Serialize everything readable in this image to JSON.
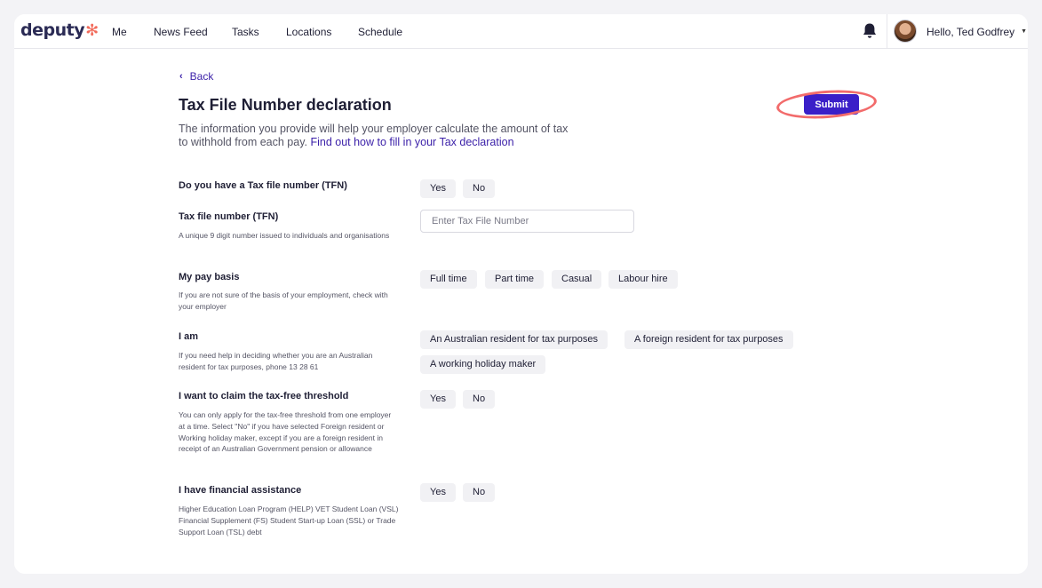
{
  "header": {
    "logo_text": "deputy",
    "nav": [
      "Me",
      "News Feed",
      "Tasks",
      "Locations",
      "Schedule"
    ],
    "user_greeting": "Hello, Ted Godfrey"
  },
  "page": {
    "back_label": "Back",
    "title": "Tax File Number declaration",
    "intro_text": "The information you provide will help your employer calculate the amount of tax to withhold from each pay.",
    "intro_link": "Find out how to fill in your Tax declaration",
    "submit_label": "Submit"
  },
  "form": {
    "has_tfn": {
      "label": "Do you have a Tax file number (TFN)",
      "options": [
        "Yes",
        "No"
      ]
    },
    "tfn": {
      "label": "Tax file number (TFN)",
      "help": "A unique 9 digit number issued to individuals and organisations",
      "placeholder": "Enter Tax File Number",
      "value": ""
    },
    "pay_basis": {
      "label": "My pay basis",
      "help": "If you are not sure of the basis of your employment, check with your employer",
      "options": [
        "Full time",
        "Part time",
        "Casual",
        "Labour hire"
      ]
    },
    "residency": {
      "label": "I am",
      "help": "If you need help in deciding whether you are an Australian resident for tax purposes, phone 13 28 61",
      "options": [
        "An Australian resident for tax purposes",
        "A foreign resident for tax purposes",
        "A working holiday maker"
      ]
    },
    "tax_free_threshold": {
      "label": "I want to claim the tax-free threshold",
      "help": "You can only apply for the tax-free threshold from one employer at a time. Select \"No\" if you have selected Foreign resident or Working holiday maker, except if you are a foreign resident in receipt of an Australian Government pension or allowance",
      "options": [
        "Yes",
        "No"
      ]
    },
    "financial_assistance": {
      "label": "I have financial assistance",
      "help": "Higher Education Loan Program (HELP) VET Student Loan (VSL) Financial Supplement (FS) Student Start-up Loan (SSL) or Trade Support Loan (TSL) debt",
      "options": [
        "Yes",
        "No"
      ]
    }
  },
  "colors": {
    "accent": "#3a1fc8",
    "link": "#3a1fa8",
    "highlight_circle": "#f26b6b",
    "logo_star": "#f26b5b"
  }
}
